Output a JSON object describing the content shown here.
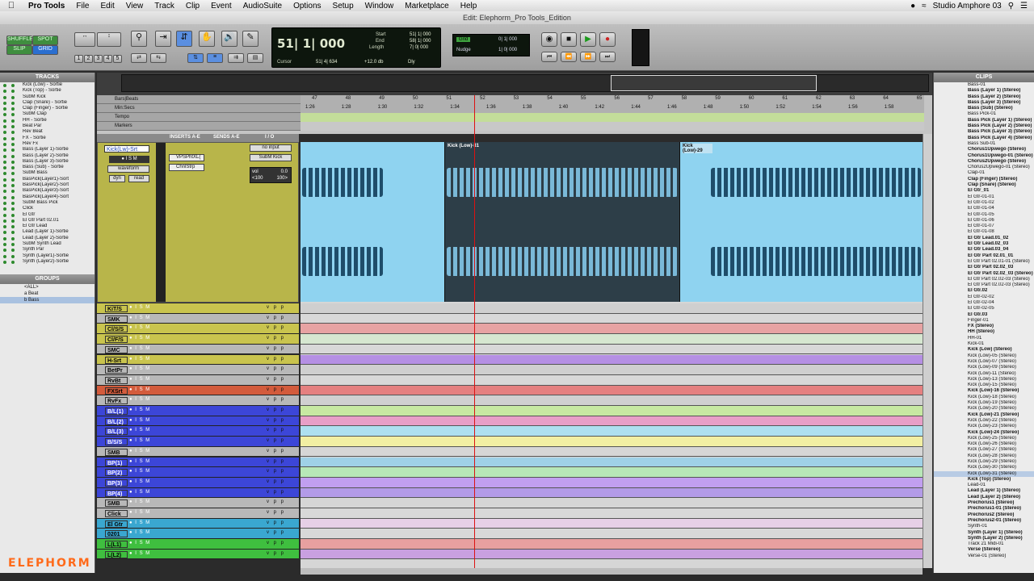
{
  "menubar": {
    "items": [
      "Pro Tools",
      "File",
      "Edit",
      "View",
      "Track",
      "Clip",
      "Event",
      "AudioSuite",
      "Options",
      "Setup",
      "Window",
      "Marketplace",
      "Help"
    ],
    "user": "Studio Amphore 03"
  },
  "window": {
    "title": "Edit: Elephorm_Pro Tools_Edition"
  },
  "toolbar": {
    "modes": [
      "SHUFFLE",
      "SPOT",
      "SLIP",
      "GRID"
    ],
    "zoom_presets": [
      "1",
      "2",
      "3",
      "4",
      "5"
    ]
  },
  "counter": {
    "main": "51| 1| 000",
    "cursor_label": "Cursor",
    "cursor_val": "51| 4| 634",
    "db": "+12.0 db",
    "dly": "Dly",
    "start_label": "Start",
    "start": "51| 1| 000",
    "end_label": "End",
    "end": "58| 1| 000",
    "length_label": "Length",
    "length": "7| 0| 000"
  },
  "grid": {
    "grid_label": "Grid",
    "grid_val": "0| 1| 000",
    "nudge_label": "Nudge",
    "nudge_val": "1| 0| 000"
  },
  "tracks_panel": {
    "title": "TRACKS",
    "items": [
      "Kick (Low) - Sortie",
      "Kick (Top) - Sortie",
      "SubM Kick",
      "Clap (Snare) - Sortie",
      "Clap (Finger) - Sortie",
      "SubM Clap",
      "HH - Sortie",
      "Beat Par",
      "Rev Beat",
      "FX - Sortie",
      "Rev Fx",
      "Bass (Layer 1)-Sortie",
      "Bass (Layer 2)-Sortie",
      "Bass (Layer 3)-Sortie",
      "Bass (Sub) - Sortie",
      "SubM Bass",
      "BasPick(Layer1)-Sort",
      "BasPick(Layer2)-Sort",
      "BasPick(Layer3)-Sort",
      "BasPick(Layer4)-Sort",
      "SubM Bass Pick",
      "Click",
      "El Gtr",
      "El Gtr Part 02.01",
      "El Gtr Lead",
      "Lead (Layer 1)-Sortie",
      "Lead (Layer 2)-Sortie",
      "SubM Synth Lead",
      "Synth Par",
      "Synth (Layer1)-Sortie",
      "Synth (Layer2)-Sortie"
    ]
  },
  "groups_panel": {
    "title": "GROUPS",
    "items": [
      "<ALL>",
      "a  Beat",
      "b  Bass"
    ]
  },
  "clips_panel": {
    "title": "CLIPS",
    "items": [
      "Bass-01",
      "Bass (Layer 1) (Stereo)",
      "Bass (Layer 2) (Stereo)",
      "Bass (Layer 3) (Stereo)",
      "Bass (Sub) (Stereo)",
      "Bass Pick-01",
      "Bass Pick (Layer 1) (Stereo)",
      "Bass Pick (Layer 2) (Stereo)",
      "Bass Pick (Layer 3) (Stereo)",
      "Bass Pick (Layer 4) (Stereo)",
      "Bass Sub-01",
      "Chorus1Upwego (Stereo)",
      "Chorus1Upwego-01 (Stereo)",
      "Chorus2Upwego (Stereo)",
      "Chorus2Upwego-01 (Stereo)",
      "Clap-01",
      "Clap (Finger) (Stereo)",
      "Clap (Snare) (Stereo)",
      "El Gtr_01",
      "El Gtr-01-01",
      "El Gtr-01-02",
      "El Gtr-01-04",
      "El Gtr-01-05",
      "El Gtr-01-06",
      "El Gtr-01-07",
      "El Gtr-01-08",
      "El Gtr Lead.01_02",
      "El Gtr Lead.02_03",
      "El Gtr Lead.03_04",
      "El Gtr Part 02.01_01",
      "El Gtr Part 02.01-01 (Stereo)",
      "El Gtr Part 02.02_03",
      "El Gtr Part 02.02_03 (Stereo)",
      "El Gtr Part 02.02-03 (Stereo)",
      "El Gtr Part 02.02-03 (Stereo)",
      "El Gtr.02",
      "El Gtr-02-02",
      "El Gtr-02-04",
      "El Gtr-02-05",
      "El Gtr.03",
      "Finger-01",
      "FX (Stereo)",
      "HH (Stereo)",
      "HH-01",
      "Kick-01",
      "Kick (Low) (Stereo)",
      "Kick (Low)-05 (Stereo)",
      "Kick (Low)-07 (Stereo)",
      "Kick (Low)-09 (Stereo)",
      "Kick (Low)-11 (Stereo)",
      "Kick (Low)-13 (Stereo)",
      "Kick (Low)-15 (Stereo)",
      "Kick (Low)-16 (Stereo)",
      "Kick (Low)-18 (Stereo)",
      "Kick (Low)-19 (Stereo)",
      "Kick (Low)-20 (Stereo)",
      "Kick (Low)-21 (Stereo)",
      "Kick (Low)-22 (Stereo)",
      "Kick (Low)-23 (Stereo)",
      "Kick (Low)-24 (Stereo)",
      "Kick (Low)-25 (Stereo)",
      "Kick (Low)-26 (Stereo)",
      "Kick (Low)-27 (Stereo)",
      "Kick (Low)-28 (Stereo)",
      "Kick (Low)-29 (Stereo)",
      "Kick (Low)-30 (Stereo)",
      "Kick (Low)-31 (Stereo)",
      "Kick (Top) (Stereo)",
      "Lead-01",
      "Lead (Layer 1) (Stereo)",
      "Lead (Layer 2) (Stereo)",
      "Prechorus1 (Stereo)",
      "Prechorus1-01 (Stereo)",
      "Prechorus2 (Stereo)",
      "Prechorus2-01 (Stereo)",
      "Synth-01",
      "Synth (Layer 1) (Stereo)",
      "Synth (Layer 2) (Stereo)",
      "Track 21 Midi-01",
      "Verse (Stereo)",
      "Verse-01 (Stereo)"
    ]
  },
  "rulers": {
    "bars_label": "Bars|Beats",
    "minsecs_label": "Min:Secs",
    "tempo_label": "Tempo",
    "markers_label": "Markers",
    "bars": [
      "47",
      "48",
      "49",
      "50",
      "51",
      "52",
      "53",
      "54",
      "55",
      "56",
      "57",
      "58",
      "59",
      "60",
      "61",
      "62",
      "63",
      "64",
      "65"
    ],
    "mins": [
      "1:26",
      "1:28",
      "1:30",
      "1:32",
      "1:34",
      "1:36",
      "1:38",
      "1:40",
      "1:42",
      "1:44",
      "1:46",
      "1:48",
      "1:50",
      "1:52",
      "1:54",
      "1:56",
      "1:58"
    ]
  },
  "mix_header": {
    "inserts": "INSERTS A-E",
    "sends": "SENDS A-E",
    "io": "I / O"
  },
  "main_track": {
    "name": "Kick(Lw)-Srt",
    "view": "waveform",
    "mode": "dyn",
    "read": "read",
    "insert1": "VPSPhtXL(",
    "insert2": "ChnlStrp",
    "input": "no input",
    "output": "SubM Kick",
    "vol_label": "vol",
    "vol": "0.0",
    "pan_l": "<100",
    "pan_r": "100>"
  },
  "clips": {
    "clip1": "Kick (Low)-31",
    "clip2": "Kick (Low)-29"
  },
  "small_tracks": [
    {
      "name": "KiT/S",
      "color": "#c9c44e"
    },
    {
      "name": "SMK",
      "color": "#b8b8b8"
    },
    {
      "name": "Cl/S/S",
      "color": "#c9c44e"
    },
    {
      "name": "Cl/F/S",
      "color": "#c9c44e"
    },
    {
      "name": "SMC",
      "color": "#b8b8b8"
    },
    {
      "name": "H-Srt",
      "color": "#c9c44e"
    },
    {
      "name": "BetPr",
      "color": "#b8b8b8"
    },
    {
      "name": "RvBt",
      "color": "#b8b8b8"
    },
    {
      "name": "FXSrt",
      "color": "#d35b3c"
    },
    {
      "name": "RvFx",
      "color": "#b8b8b8"
    },
    {
      "name": "B/L(1)",
      "color": "#3c46d8"
    },
    {
      "name": "B/L(2)",
      "color": "#3c46d8"
    },
    {
      "name": "B/L(3)",
      "color": "#3c46d8"
    },
    {
      "name": "B/S/S",
      "color": "#3c46d8"
    },
    {
      "name": "SMB",
      "color": "#b8b8b8"
    },
    {
      "name": "BP(1)",
      "color": "#3c46d8"
    },
    {
      "name": "BP(2)",
      "color": "#3c46d8"
    },
    {
      "name": "BP(3)",
      "color": "#3c46d8"
    },
    {
      "name": "BP(4)",
      "color": "#3c46d8"
    },
    {
      "name": "SMB",
      "color": "#b8b8b8"
    },
    {
      "name": "Click",
      "color": "#b8b8b8"
    },
    {
      "name": "El Gtr",
      "color": "#3aa7d0"
    },
    {
      "name": "0201",
      "color": "#3aa7d0"
    },
    {
      "name": "L(L1)",
      "color": "#3fbf3f"
    },
    {
      "name": "L(L2)",
      "color": "#3fbf3f"
    }
  ],
  "lane_colors": [
    "#cfcfcf",
    "#d8d8d8",
    "#e7a3a3",
    "#d6e7d0",
    "#d8d8d8",
    "#b58fe4",
    "#cfcfcf",
    "#d8d8d8",
    "#e58080",
    "#d0d0d0",
    "#c7e9a2",
    "#e89fc7",
    "#aee0f0",
    "#f2efa3",
    "#d6d6d6",
    "#9fd1e7",
    "#b7e7b7",
    "#c19ff0",
    "#b39be8",
    "#d6d6d6",
    "#d8d8d8",
    "#e7d0e7",
    "#d8d8d8",
    "#e7a0a0",
    "#c9a0e0"
  ],
  "brand": {
    "logo": "ELEPHORM"
  }
}
